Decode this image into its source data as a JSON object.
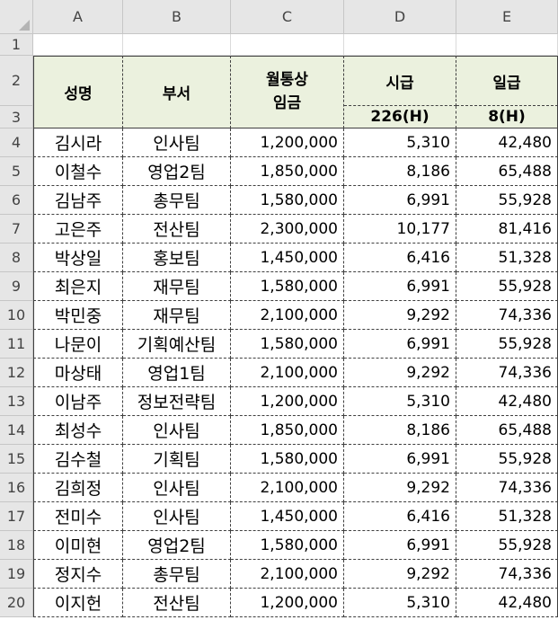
{
  "columns": [
    "A",
    "B",
    "C",
    "D",
    "E"
  ],
  "header": {
    "name": "성명",
    "dept": "부서",
    "wage_line1": "월통상",
    "wage_line2": "임금",
    "hourly": "시급",
    "daily": "일급",
    "hourly_sub": "226(H)",
    "daily_sub": "8(H)"
  },
  "row_numbers": [
    "1",
    "2",
    "3",
    "4",
    "5",
    "6",
    "7",
    "8",
    "9",
    "10",
    "11",
    "12",
    "13",
    "14",
    "15",
    "16",
    "17",
    "18",
    "19",
    "20"
  ],
  "rows": [
    {
      "name": "김시라",
      "dept": "인사팀",
      "wage": "1,200,000",
      "hourly": "5,310",
      "daily": "42,480"
    },
    {
      "name": "이철수",
      "dept": "영업2팀",
      "wage": "1,850,000",
      "hourly": "8,186",
      "daily": "65,488"
    },
    {
      "name": "김남주",
      "dept": "총무팀",
      "wage": "1,580,000",
      "hourly": "6,991",
      "daily": "55,928"
    },
    {
      "name": "고은주",
      "dept": "전산팀",
      "wage": "2,300,000",
      "hourly": "10,177",
      "daily": "81,416"
    },
    {
      "name": "박상일",
      "dept": "홍보팀",
      "wage": "1,450,000",
      "hourly": "6,416",
      "daily": "51,328"
    },
    {
      "name": "최은지",
      "dept": "재무팀",
      "wage": "1,580,000",
      "hourly": "6,991",
      "daily": "55,928"
    },
    {
      "name": "박민중",
      "dept": "재무팀",
      "wage": "2,100,000",
      "hourly": "9,292",
      "daily": "74,336"
    },
    {
      "name": "나문이",
      "dept": "기획예산팀",
      "wage": "1,580,000",
      "hourly": "6,991",
      "daily": "55,928"
    },
    {
      "name": "마상태",
      "dept": "영업1팀",
      "wage": "2,100,000",
      "hourly": "9,292",
      "daily": "74,336"
    },
    {
      "name": "이남주",
      "dept": "정보전략팀",
      "wage": "1,200,000",
      "hourly": "5,310",
      "daily": "42,480"
    },
    {
      "name": "최성수",
      "dept": "인사팀",
      "wage": "1,850,000",
      "hourly": "8,186",
      "daily": "65,488"
    },
    {
      "name": "김수철",
      "dept": "기획팀",
      "wage": "1,580,000",
      "hourly": "6,991",
      "daily": "55,928"
    },
    {
      "name": "김희정",
      "dept": "인사팀",
      "wage": "2,100,000",
      "hourly": "9,292",
      "daily": "74,336"
    },
    {
      "name": "전미수",
      "dept": "인사팀",
      "wage": "1,450,000",
      "hourly": "6,416",
      "daily": "51,328"
    },
    {
      "name": "이미현",
      "dept": "영업2팀",
      "wage": "1,580,000",
      "hourly": "6,991",
      "daily": "55,928"
    },
    {
      "name": "정지수",
      "dept": "총무팀",
      "wage": "2,100,000",
      "hourly": "9,292",
      "daily": "74,336"
    },
    {
      "name": "이지헌",
      "dept": "전산팀",
      "wage": "1,200,000",
      "hourly": "5,310",
      "daily": "42,480"
    }
  ],
  "colors": {
    "header_fill": "#ebf1de",
    "grid": "#dadada",
    "border": "#404040",
    "header_bg": "#e6e6e6"
  }
}
